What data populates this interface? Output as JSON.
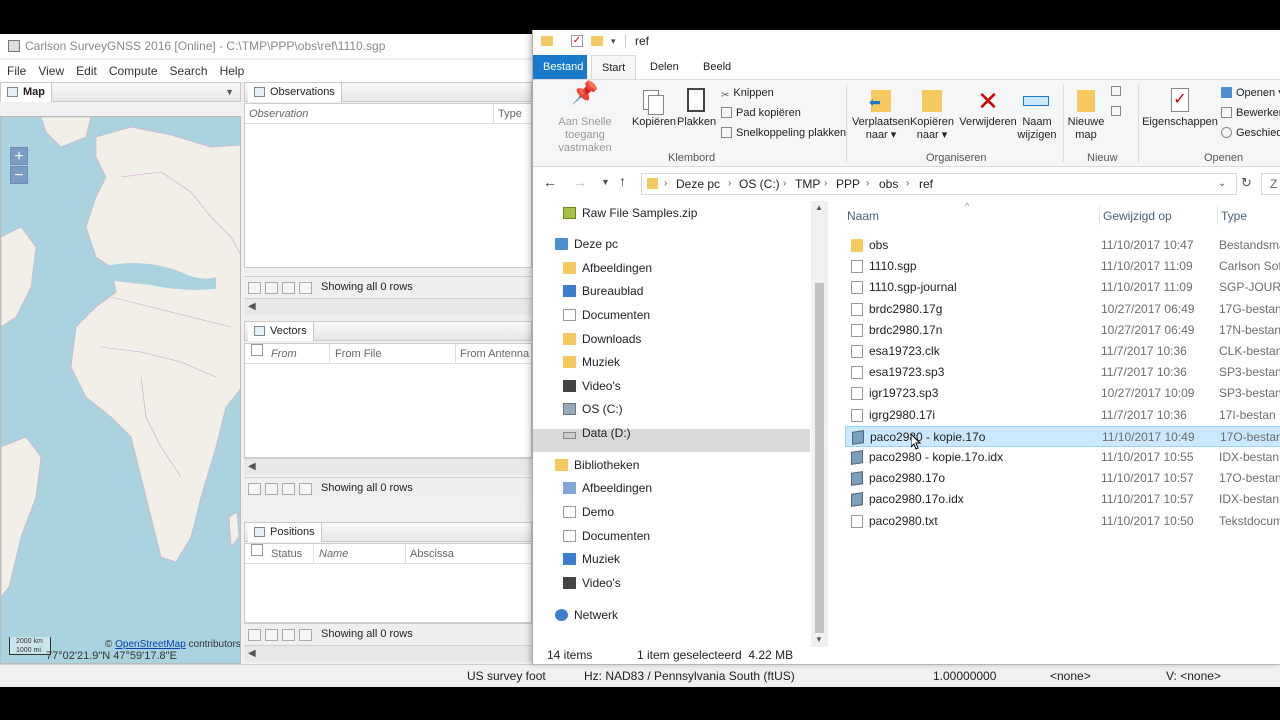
{
  "carlson": {
    "title": "Carlson SurveyGNSS 2016   [Online] - C:\\TMP\\PPP\\obs\\ref\\1110.sgp",
    "menu": [
      "File",
      "View",
      "Edit",
      "Compute",
      "Search",
      "Help"
    ],
    "map": {
      "tab": "Map",
      "zoom_in": "+",
      "zoom_out": "−",
      "scale_km": "2000 km",
      "scale_mi": "1000 mi",
      "attribution_prefix": "©",
      "attribution_link": "OpenStreetMap",
      "attribution_suffix": "contributors",
      "coords": "77°02'21.9\"N 47°59'17.8\"E"
    },
    "observations": {
      "tab": "Observations",
      "columns": [
        "Observation",
        "Type"
      ],
      "pager_text": "Showing all 0 rows"
    },
    "vectors": {
      "tab": "Vectors",
      "columns": [
        "From",
        "From File",
        "From Antenna H"
      ],
      "pager_text": "Showing all 0 rows"
    },
    "positions": {
      "tab": "Positions",
      "columns": [
        "Status",
        "Name",
        "Abscissa"
      ],
      "pager_text": "Showing all 0 rows"
    },
    "status": {
      "units": "US survey foot",
      "hz": "Hz: NAD83 / Pennsylvania South (ftUS)",
      "scale": "1.00000000",
      "none1": "<none>",
      "v": "V: <none>"
    }
  },
  "explorer": {
    "title": "ref",
    "tabs": [
      "Bestand",
      "Start",
      "Delen",
      "Beeld"
    ],
    "ribbon": {
      "pin": [
        "Aan Snelle toegang",
        "vastmaken"
      ],
      "copy": "Kopiëren",
      "paste": "Plakken",
      "cut": "Knippen",
      "copy_path": "Pad kopiëren",
      "paste_shortcut": "Snelkoppeling plakken",
      "group_clipboard": "Klembord",
      "move_to": [
        "Verplaatsen",
        "naar ▾"
      ],
      "copy_to": [
        "Kopiëren",
        "naar ▾"
      ],
      "delete": "Verwijderen",
      "rename": [
        "Naam",
        "wijzigen"
      ],
      "group_organize": "Organiseren",
      "new_folder": [
        "Nieuwe",
        "map"
      ],
      "group_new": "Nieuw",
      "properties": "Eigenschappen",
      "open": "Openen ▾",
      "edit": "Bewerken",
      "history": "Geschiedenis",
      "group_open": "Openen"
    },
    "address": {
      "crumbs": [
        "Deze pc",
        "OS (C:)",
        "TMP",
        "PPP",
        "obs",
        "ref"
      ],
      "search_placeholder": "Z"
    },
    "nav": [
      {
        "label": "Raw File Samples.zip",
        "indent": 1,
        "icon": "zip"
      },
      {
        "label": "Deze pc",
        "indent": 0,
        "icon": "pc"
      },
      {
        "label": "Afbeeldingen",
        "indent": 1,
        "icon": "pics"
      },
      {
        "label": "Bureaublad",
        "indent": 1,
        "icon": "desk"
      },
      {
        "label": "Documenten",
        "indent": 1,
        "icon": "docs"
      },
      {
        "label": "Downloads",
        "indent": 1,
        "icon": "dl"
      },
      {
        "label": "Muziek",
        "indent": 1,
        "icon": "music"
      },
      {
        "label": "Video's",
        "indent": 1,
        "icon": "video"
      },
      {
        "label": "OS (C:)",
        "indent": 1,
        "icon": "drive"
      },
      {
        "label": "Data (D:)",
        "indent": 1,
        "icon": "drive2"
      },
      {
        "label": "Bibliotheken",
        "indent": 0,
        "icon": "lib"
      },
      {
        "label": "Afbeeldingen",
        "indent": 1,
        "icon": "pics"
      },
      {
        "label": "Demo",
        "indent": 1,
        "icon": "docs"
      },
      {
        "label": "Documenten",
        "indent": 1,
        "icon": "docs"
      },
      {
        "label": "Muziek",
        "indent": 1,
        "icon": "music"
      },
      {
        "label": "Video's",
        "indent": 1,
        "icon": "video"
      },
      {
        "label": "Netwerk",
        "indent": 0,
        "icon": "net"
      }
    ],
    "columns": {
      "name": "Naam",
      "modified": "Gewijzigd op",
      "type": "Type"
    },
    "files": [
      {
        "name": "obs",
        "modified": "11/10/2017 10:47",
        "type": "Bestandsma",
        "icon": "folder"
      },
      {
        "name": "1110.sgp",
        "modified": "11/10/2017 11:09",
        "type": "Carlson Sof",
        "icon": "doc"
      },
      {
        "name": "1110.sgp-journal",
        "modified": "11/10/2017 11:09",
        "type": "SGP-JOURN",
        "icon": "doc"
      },
      {
        "name": "brdc2980.17g",
        "modified": "10/27/2017 06:49",
        "type": "17G-bestan",
        "icon": "doc"
      },
      {
        "name": "brdc2980.17n",
        "modified": "10/27/2017 06:49",
        "type": "17N-bestan",
        "icon": "doc"
      },
      {
        "name": "esa19723.clk",
        "modified": "11/7/2017 10:36",
        "type": "CLK-bestan",
        "icon": "doc"
      },
      {
        "name": "esa19723.sp3",
        "modified": "11/7/2017 10:36",
        "type": "SP3-bestan",
        "icon": "doc"
      },
      {
        "name": "igr19723.sp3",
        "modified": "10/27/2017 10:09",
        "type": "SP3-bestan",
        "icon": "doc"
      },
      {
        "name": "igrg2980.17i",
        "modified": "11/7/2017 10:36",
        "type": "17I-bestan",
        "icon": "doc"
      },
      {
        "name": "paco2980 - kopie.17o",
        "modified": "11/10/2017 10:49",
        "type": "17O-bestan",
        "icon": "sgp",
        "selected": true
      },
      {
        "name": "paco2980 - kopie.17o.idx",
        "modified": "11/10/2017 10:55",
        "type": "IDX-bestan",
        "icon": "sgp"
      },
      {
        "name": "paco2980.17o",
        "modified": "11/10/2017 10:57",
        "type": "17O-bestan",
        "icon": "sgp"
      },
      {
        "name": "paco2980.17o.idx",
        "modified": "11/10/2017 10:57",
        "type": "IDX-bestan",
        "icon": "sgp"
      },
      {
        "name": "paco2980.txt",
        "modified": "11/10/2017 10:50",
        "type": "Tekstdocum",
        "icon": "doc"
      }
    ],
    "status": {
      "count": "14 items",
      "selected": "1 item geselecteerd  4.22 MB"
    }
  },
  "colors": {
    "accent": "#1979ca",
    "selection": "#cce8ff",
    "map_water": "#aad3df",
    "map_land": "#f2efe9"
  }
}
